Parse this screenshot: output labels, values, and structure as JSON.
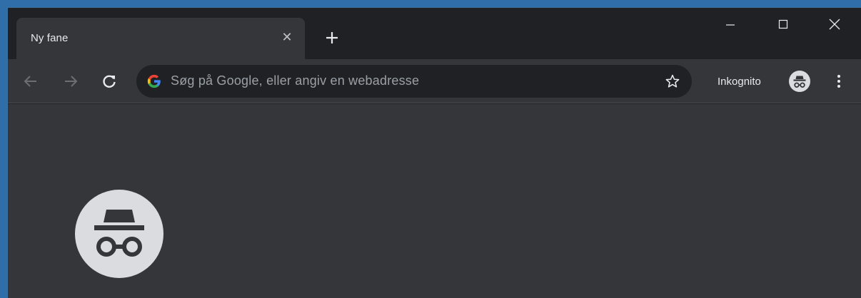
{
  "tab": {
    "title": "Ny fane"
  },
  "omnibox": {
    "placeholder": "Søg på Google, eller angiv en webadresse"
  },
  "profile": {
    "label": "Inkognito"
  },
  "colors": {
    "frame": "#202124",
    "toolbar": "#35363a",
    "omnibox": "#202124",
    "text": "#e8eaed",
    "muted_text": "#9aa0a6",
    "icon_light": "#dadce0"
  },
  "icons": {
    "back": "arrow-left-icon",
    "forward": "arrow-right-icon",
    "reload": "reload-icon",
    "google": "google-logo-icon",
    "bookmark": "star-icon",
    "incognito": "incognito-icon",
    "menu": "three-dots-vertical-icon",
    "minimize": "minimize-icon",
    "maximize": "maximize-icon",
    "close": "close-icon",
    "new_tab": "plus-icon",
    "tab_close": "close-icon"
  }
}
